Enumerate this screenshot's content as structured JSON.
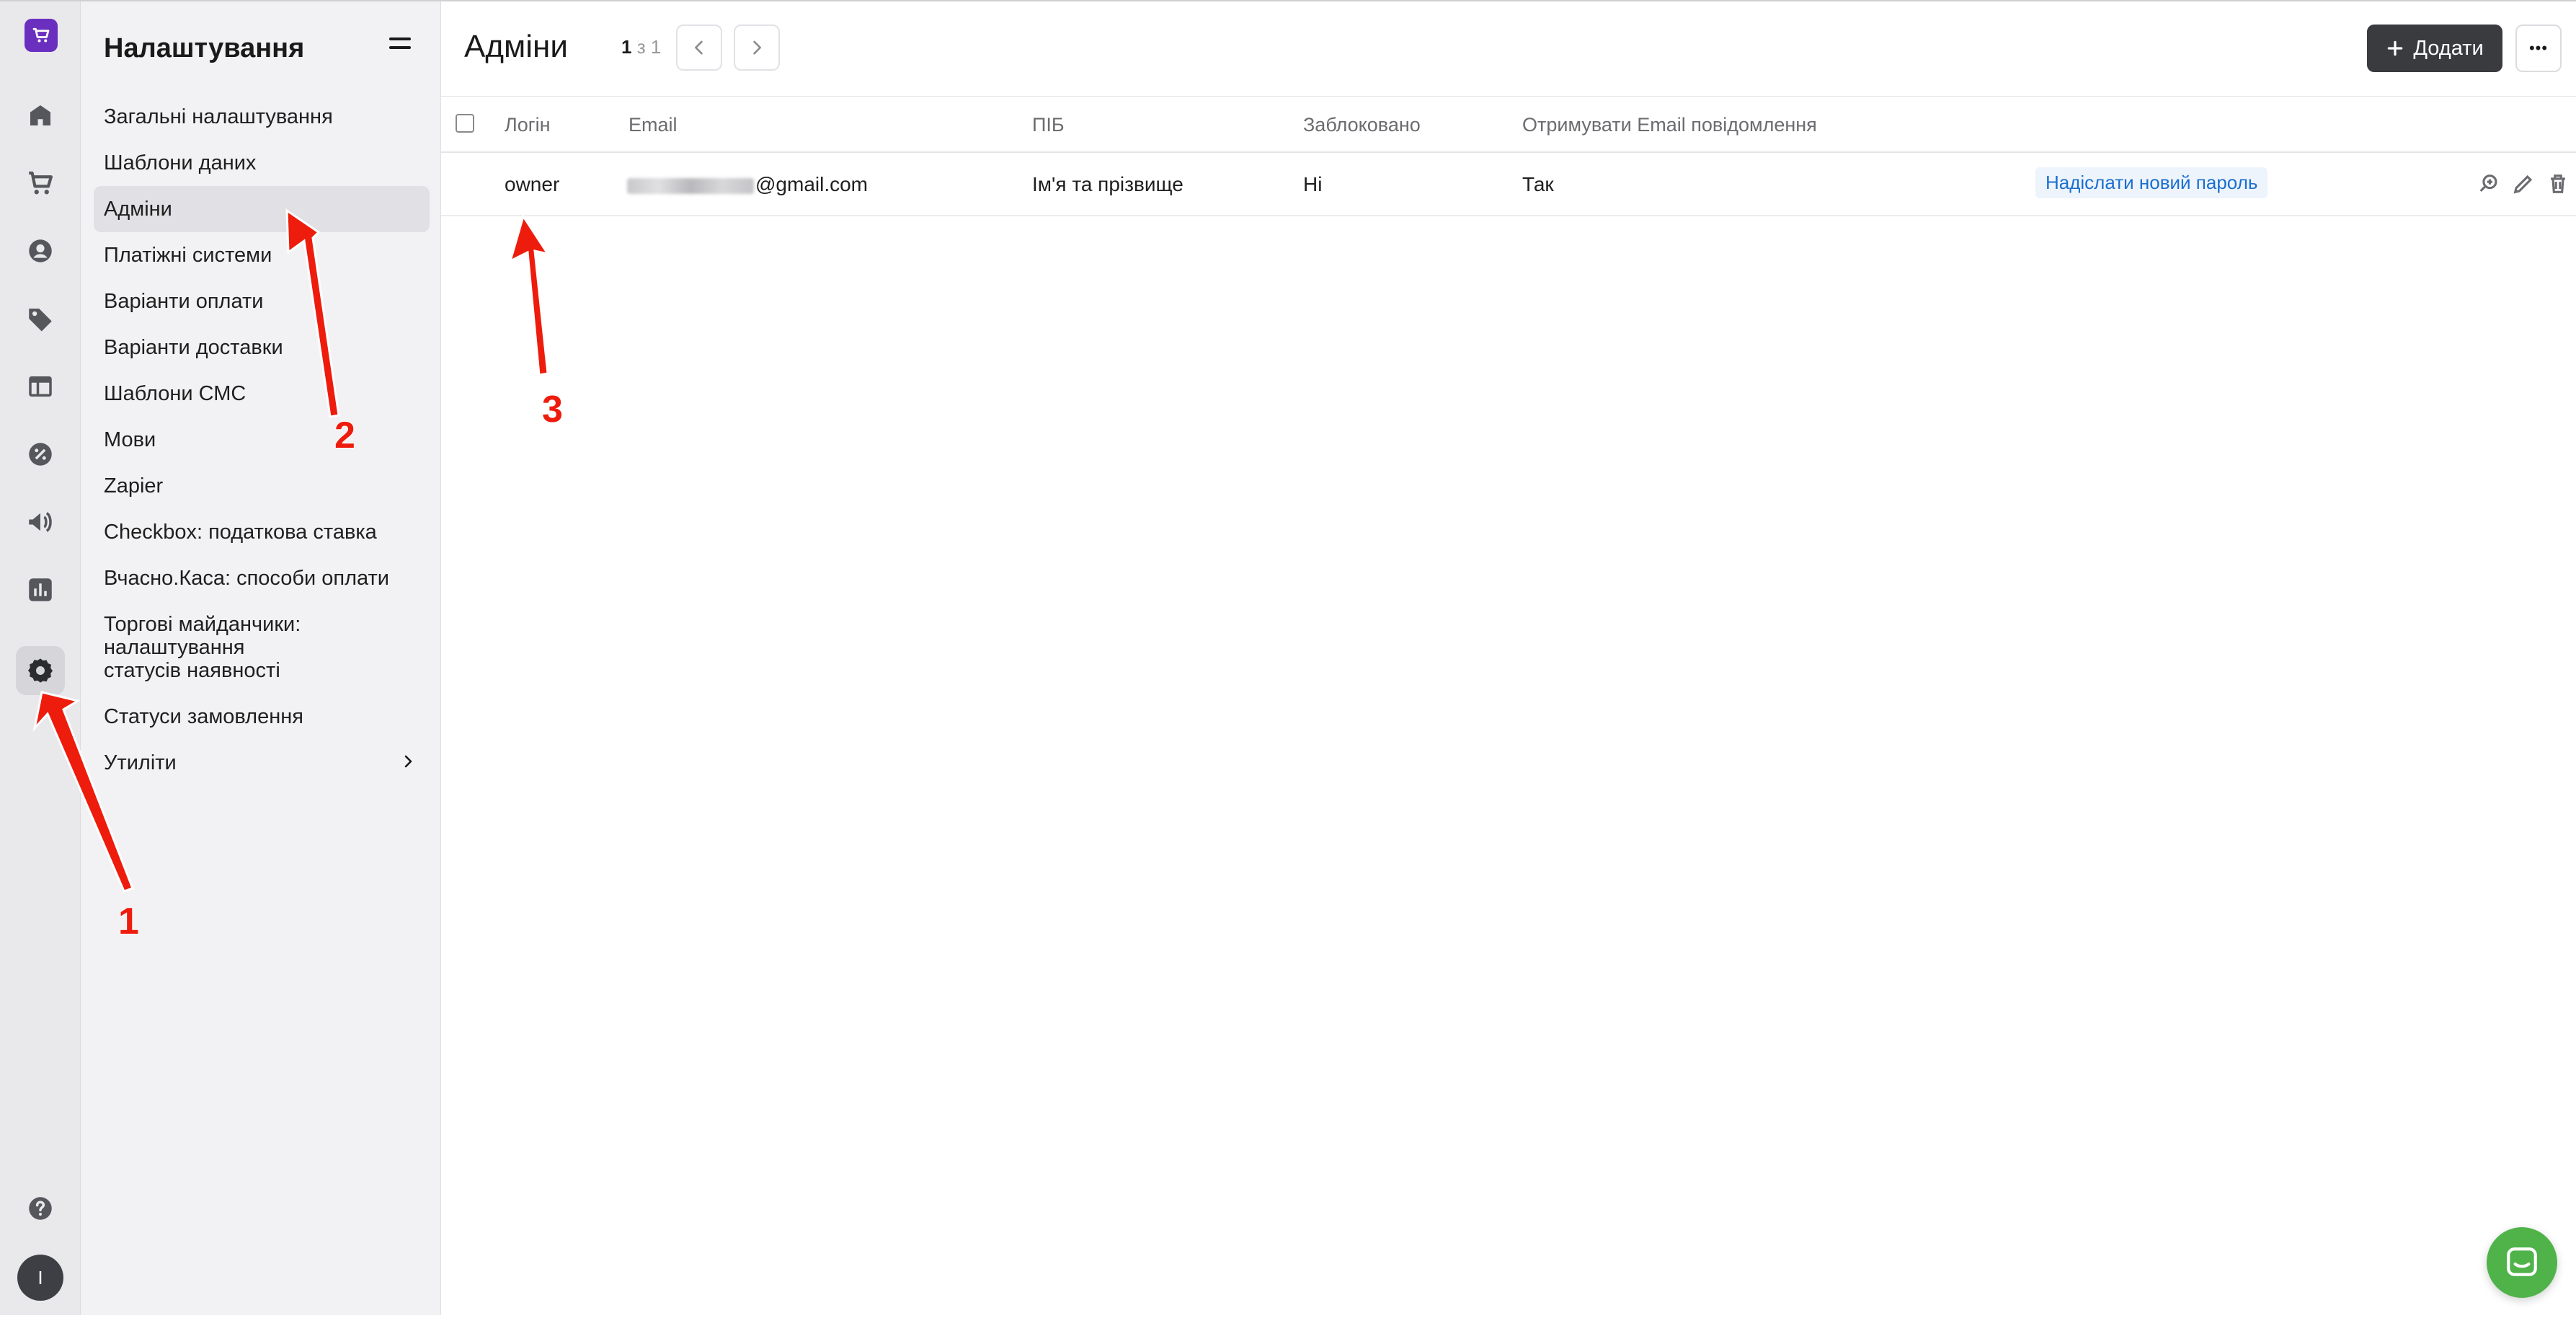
{
  "rail": {
    "items": [
      {
        "name": "home-icon"
      },
      {
        "name": "cart-icon"
      },
      {
        "name": "customer-icon"
      },
      {
        "name": "tag-icon"
      },
      {
        "name": "layout-icon"
      },
      {
        "name": "discount-icon"
      },
      {
        "name": "megaphone-icon"
      },
      {
        "name": "chart-icon"
      },
      {
        "name": "gear-icon",
        "active": true
      }
    ],
    "help_icon": "question-icon",
    "avatar_letter": "I"
  },
  "menu": {
    "title": "Налаштування",
    "items": [
      {
        "label": "Загальні налаштування"
      },
      {
        "label": "Шаблони даних"
      },
      {
        "label": "Адміни",
        "active": true
      },
      {
        "label": "Платіжні системи"
      },
      {
        "label": "Варіанти оплати"
      },
      {
        "label": "Варіанти доставки"
      },
      {
        "label": "Шаблони СМС"
      },
      {
        "label": "Мови"
      },
      {
        "label": "Zapier"
      },
      {
        "label": "Checkbox: податкова ставка"
      },
      {
        "label": "Вчасно.Каса: способи оплати"
      },
      {
        "label": "Торгові майданчики: налаштування статусів наявності"
      },
      {
        "label": "Статуси замовлення"
      },
      {
        "label": "Утиліти",
        "has_submenu": true
      }
    ]
  },
  "header": {
    "title": "Адміни",
    "pager_current": "1",
    "pager_separator": "з",
    "pager_total": "1",
    "add_label": "Додати",
    "more_label": "•••"
  },
  "table": {
    "columns": [
      "Логін",
      "Email",
      "ПІБ",
      "Заблоковано",
      "Отримувати Email повідомлення"
    ],
    "rows": [
      {
        "login": "owner",
        "email_suffix": "@gmail.com",
        "full_name": "Ім'я та прізвище",
        "blocked": "Ні",
        "email_notifications": "Так",
        "action_link": "Надіслати новий пароль"
      }
    ]
  },
  "annotations": {
    "labels": [
      "1",
      "2",
      "3"
    ],
    "color": "#ee1c0c"
  },
  "colors": {
    "brand": "#6b2fbf",
    "primary_button": "#3a3b3f",
    "link": "#1a6fcf",
    "chat": "#4fb34a"
  }
}
